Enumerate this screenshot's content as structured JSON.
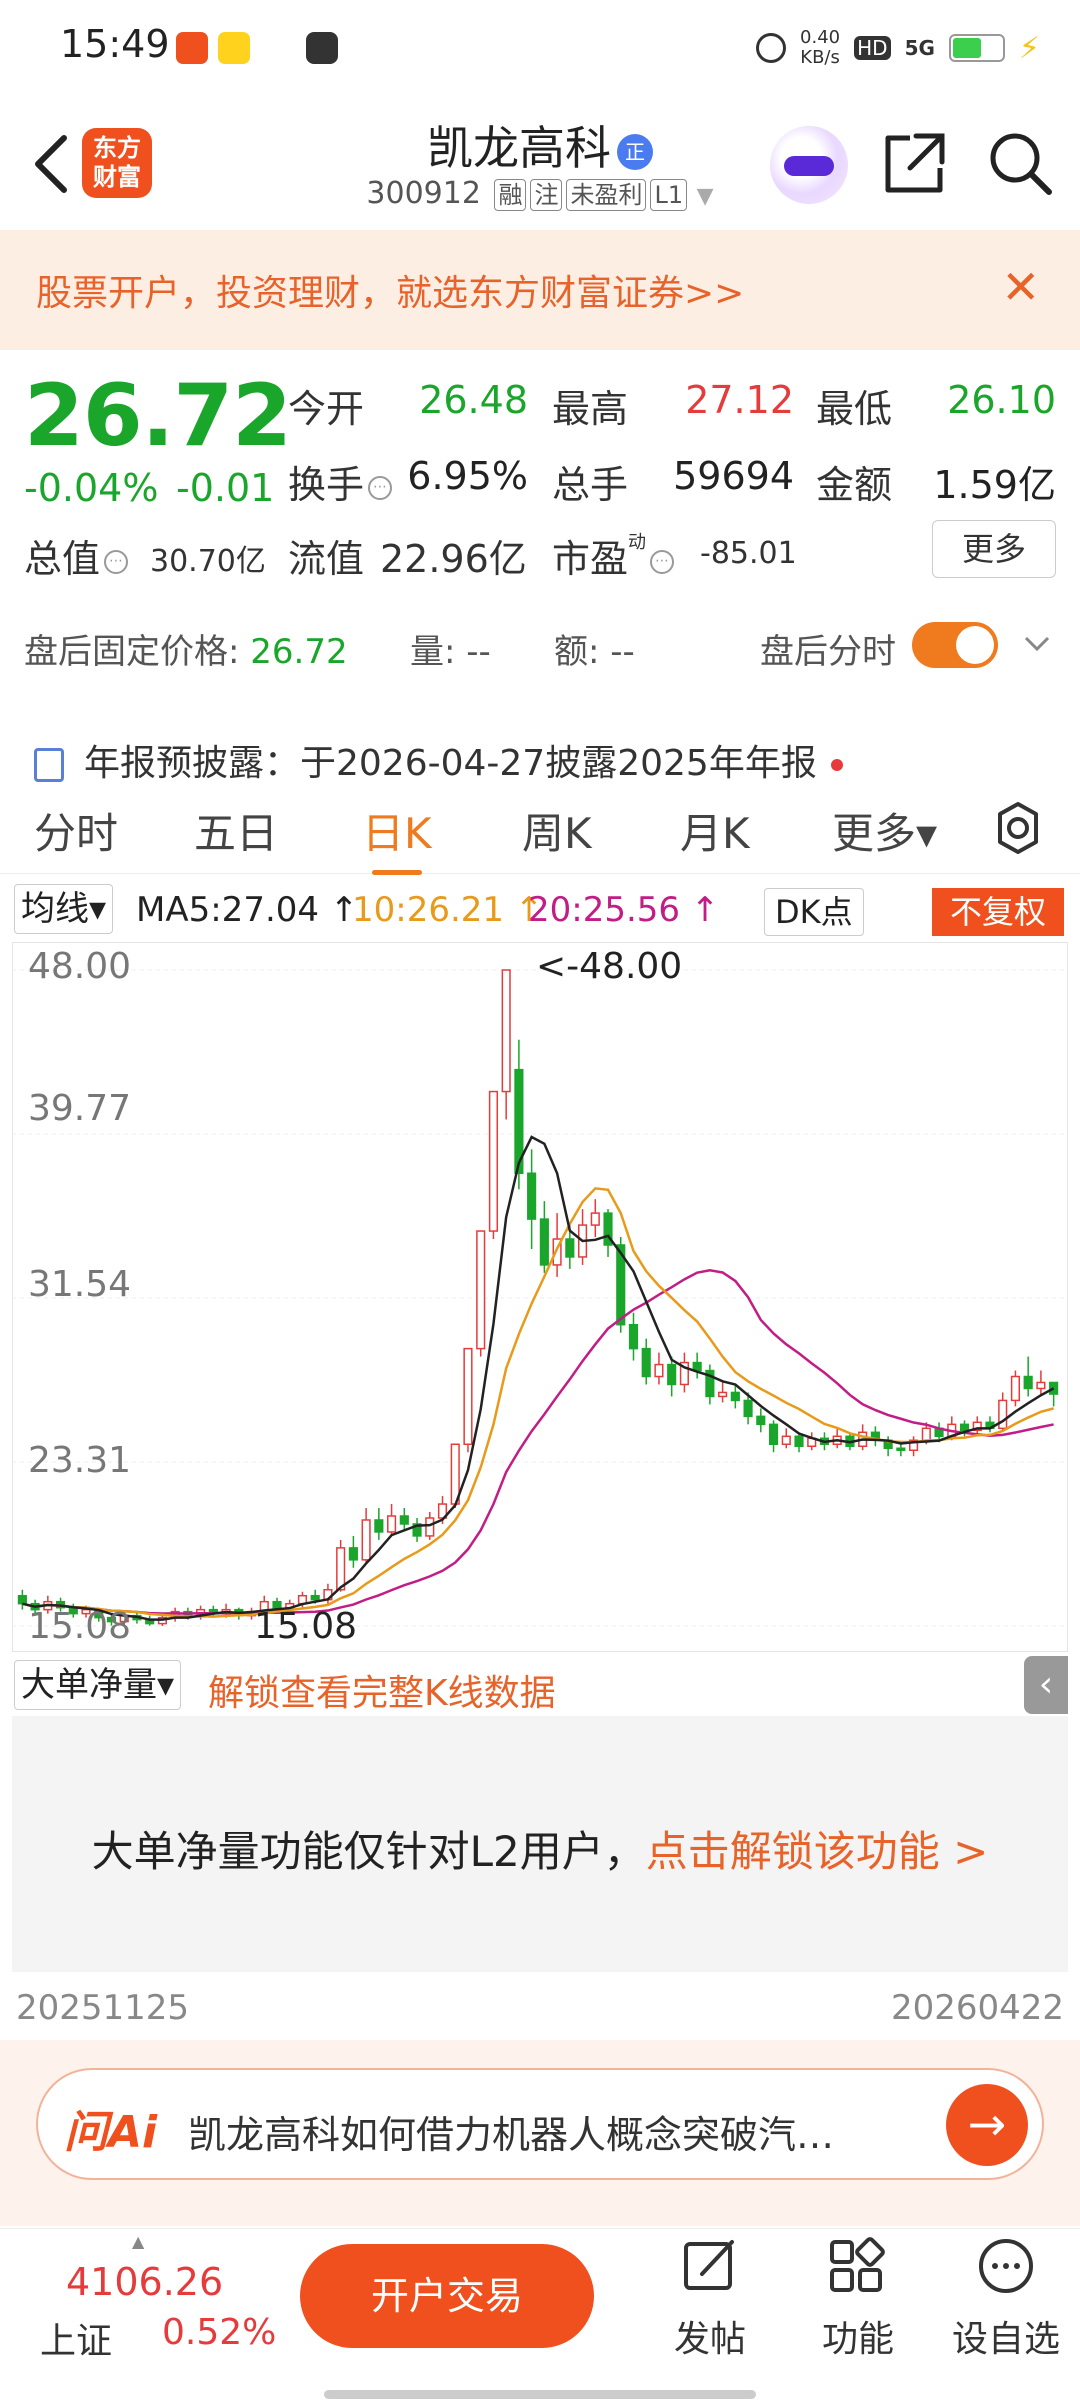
{
  "status_bar": {
    "time": "15:49",
    "net_speed_top": "0.40",
    "net_speed_unit": "KB/s",
    "hd": "HD",
    "signal": "5G"
  },
  "header": {
    "logo_line1": "东方",
    "logo_line2": "财富",
    "stock_name": "凯龙高科",
    "name_badge": "正",
    "stock_code": "300912",
    "tags": [
      "融",
      "注",
      "未盈利",
      "L1"
    ]
  },
  "banner": {
    "text": "股票开户，投资理财，就选东方财富证券>>",
    "close": "✕"
  },
  "quote": {
    "price": "26.72",
    "change_pct": "-0.04%",
    "change_amt": "-0.01",
    "open_label": "今开",
    "open": "26.48",
    "high_label": "最高",
    "high": "27.12",
    "low_label": "最低",
    "low": "26.10",
    "turnover_label": "换手",
    "turnover": "6.95%",
    "volume_label": "总手",
    "volume": "59694",
    "amount_label": "金额",
    "amount": "1.59亿",
    "mktcap_label": "总值",
    "mktcap": "30.70亿",
    "float_label": "流值",
    "float_cap": "22.96亿",
    "pe_label": "市盈",
    "pe_sup": "动",
    "pe": "-85.01",
    "more_button": "更多"
  },
  "after_hours": {
    "label": "盘后固定价格:",
    "price": "26.72",
    "vol_label": "量:",
    "vol": "--",
    "amt_label": "额:",
    "amt": "--",
    "toggle_label": "盘后分时"
  },
  "notice": {
    "text": "年报预披露：于2026-04-27披露2025年年报"
  },
  "tabs": [
    "分时",
    "五日",
    "日K",
    "周K",
    "月K",
    "更多▾"
  ],
  "active_tab": "日K",
  "indicator_row": {
    "selector": "均线▾",
    "ma5": "MA5:27.04 ↑",
    "ma10": "10:26.21 ↑",
    "ma20": "20:25.56 ↑",
    "dk": "DK点",
    "adjust": "不复权"
  },
  "chart_data": {
    "type": "candlestick",
    "y_ticks": [
      "48.00",
      "39.77",
      "31.54",
      "23.31",
      "15.08"
    ],
    "ylim": [
      15.08,
      48.0
    ],
    "annotations": [
      "<-48.00",
      "15.08"
    ],
    "x_range_labels": [
      "20251125",
      "20260422"
    ],
    "ma_colors": {
      "ma5": "#222222",
      "ma10": "#e89a1a",
      "ma20": "#c21d86"
    },
    "up_color": "#e63b3b",
    "down_color": "#1aa52b",
    "candles": [
      [
        16.6,
        16.2,
        16.9,
        15.9
      ],
      [
        16.2,
        15.9,
        16.4,
        15.7
      ],
      [
        15.9,
        16.3,
        16.6,
        15.7
      ],
      [
        16.3,
        16.0,
        16.5,
        15.8
      ],
      [
        16.0,
        15.7,
        16.2,
        15.5
      ],
      [
        15.7,
        15.9,
        16.1,
        15.5
      ],
      [
        15.9,
        15.5,
        16.0,
        15.3
      ],
      [
        15.5,
        15.3,
        15.7,
        15.1
      ],
      [
        15.3,
        15.6,
        15.8,
        15.1
      ],
      [
        15.6,
        15.4,
        15.8,
        15.2
      ],
      [
        15.4,
        15.2,
        15.6,
        15.1
      ],
      [
        15.2,
        15.5,
        15.7,
        15.08
      ],
      [
        15.5,
        15.8,
        16.0,
        15.3
      ],
      [
        15.8,
        15.6,
        16.0,
        15.4
      ],
      [
        15.6,
        15.9,
        16.1,
        15.4
      ],
      [
        15.9,
        15.7,
        16.1,
        15.5
      ],
      [
        15.7,
        15.9,
        16.2,
        15.5
      ],
      [
        15.9,
        15.6,
        16.0,
        15.4
      ],
      [
        15.6,
        15.8,
        16.0,
        15.4
      ],
      [
        15.8,
        16.3,
        16.6,
        15.6
      ],
      [
        16.3,
        16.0,
        16.5,
        15.8
      ],
      [
        16.0,
        16.2,
        16.4,
        15.9
      ],
      [
        16.2,
        16.6,
        16.8,
        16.0
      ],
      [
        16.6,
        16.4,
        16.9,
        16.2
      ],
      [
        16.4,
        16.9,
        17.2,
        16.2
      ],
      [
        16.9,
        19.0,
        19.4,
        16.8
      ],
      [
        19.0,
        18.4,
        19.6,
        18.0
      ],
      [
        18.4,
        20.4,
        21.0,
        18.2
      ],
      [
        20.4,
        19.8,
        21.0,
        19.4
      ],
      [
        19.8,
        20.6,
        21.2,
        19.6
      ],
      [
        20.6,
        20.2,
        21.0,
        19.9
      ],
      [
        20.2,
        19.6,
        20.5,
        19.3
      ],
      [
        19.6,
        20.5,
        20.8,
        19.4
      ],
      [
        20.5,
        21.2,
        21.6,
        20.2
      ],
      [
        21.2,
        24.2,
        24.2,
        21.0
      ],
      [
        24.2,
        29.0,
        29.0,
        23.8
      ],
      [
        29.0,
        34.9,
        34.9,
        28.6
      ],
      [
        34.9,
        41.9,
        41.9,
        34.5
      ],
      [
        41.9,
        48.0,
        48.0,
        40.5
      ],
      [
        43.0,
        37.8,
        44.5,
        37.0
      ],
      [
        37.8,
        35.5,
        39.0,
        34.0
      ],
      [
        35.5,
        33.2,
        36.4,
        32.8
      ],
      [
        33.2,
        34.5,
        35.8,
        32.6
      ],
      [
        34.5,
        33.6,
        35.2,
        33.0
      ],
      [
        33.6,
        35.2,
        36.0,
        33.2
      ],
      [
        35.2,
        35.8,
        36.5,
        34.6
      ],
      [
        35.8,
        34.2,
        36.0,
        33.6
      ],
      [
        34.2,
        30.2,
        34.6,
        29.8
      ],
      [
        30.2,
        29.0,
        30.8,
        28.4
      ],
      [
        29.0,
        27.6,
        29.5,
        27.2
      ],
      [
        27.6,
        28.2,
        28.8,
        27.2
      ],
      [
        28.2,
        27.2,
        28.6,
        26.6
      ],
      [
        27.2,
        28.3,
        28.8,
        26.8
      ],
      [
        28.3,
        27.9,
        28.8,
        27.5
      ],
      [
        27.9,
        26.6,
        28.2,
        26.2
      ],
      [
        26.6,
        26.8,
        27.4,
        26.3
      ],
      [
        26.8,
        26.4,
        27.2,
        26.0
      ],
      [
        26.4,
        25.6,
        26.8,
        25.2
      ],
      [
        25.6,
        25.2,
        26.0,
        24.8
      ],
      [
        25.2,
        24.2,
        25.4,
        23.8
      ],
      [
        24.2,
        24.6,
        25.0,
        24.0
      ],
      [
        24.6,
        24.1,
        24.8,
        23.8
      ],
      [
        24.1,
        24.5,
        24.8,
        23.9
      ],
      [
        24.5,
        24.2,
        24.8,
        23.9
      ],
      [
        24.2,
        24.6,
        25.0,
        24.0
      ],
      [
        24.6,
        24.1,
        24.8,
        23.9
      ],
      [
        24.1,
        24.8,
        25.2,
        23.9
      ],
      [
        24.8,
        24.4,
        25.1,
        24.1
      ],
      [
        24.4,
        24.0,
        24.6,
        23.6
      ],
      [
        24.0,
        23.9,
        24.3,
        23.6
      ],
      [
        23.9,
        24.4,
        24.6,
        23.6
      ],
      [
        24.4,
        25.0,
        25.3,
        24.2
      ],
      [
        25.0,
        24.6,
        25.3,
        24.3
      ],
      [
        24.6,
        25.2,
        25.6,
        24.4
      ],
      [
        25.2,
        24.9,
        25.4,
        24.6
      ],
      [
        24.9,
        25.3,
        25.6,
        24.6
      ],
      [
        25.3,
        25.0,
        25.6,
        24.8
      ],
      [
        25.0,
        26.4,
        26.8,
        24.9
      ],
      [
        26.4,
        27.6,
        27.9,
        26.1
      ],
      [
        27.6,
        27.0,
        28.6,
        26.6
      ],
      [
        27.0,
        27.3,
        27.9,
        26.6
      ],
      [
        27.3,
        26.72,
        27.12,
        26.1
      ]
    ]
  },
  "sub_chart": {
    "selector": "大单净量▾",
    "unlock_link": "解锁查看完整K线数据",
    "collapse_arrow": "‹",
    "message": "大单净量功能仅针对L2用户，",
    "message_link": "点击解锁该功能 >"
  },
  "ai_bar": {
    "logo": "问Ai",
    "text": "凯龙高科如何借力机器人概念突破汽…",
    "go": "→"
  },
  "bottom_bar": {
    "index_value": "4106.26",
    "index_name": "上证",
    "index_pct": "0.52%",
    "trade_button": "开户交易",
    "post_label": "发帖",
    "func_label": "功能",
    "watch_label": "设自选"
  }
}
